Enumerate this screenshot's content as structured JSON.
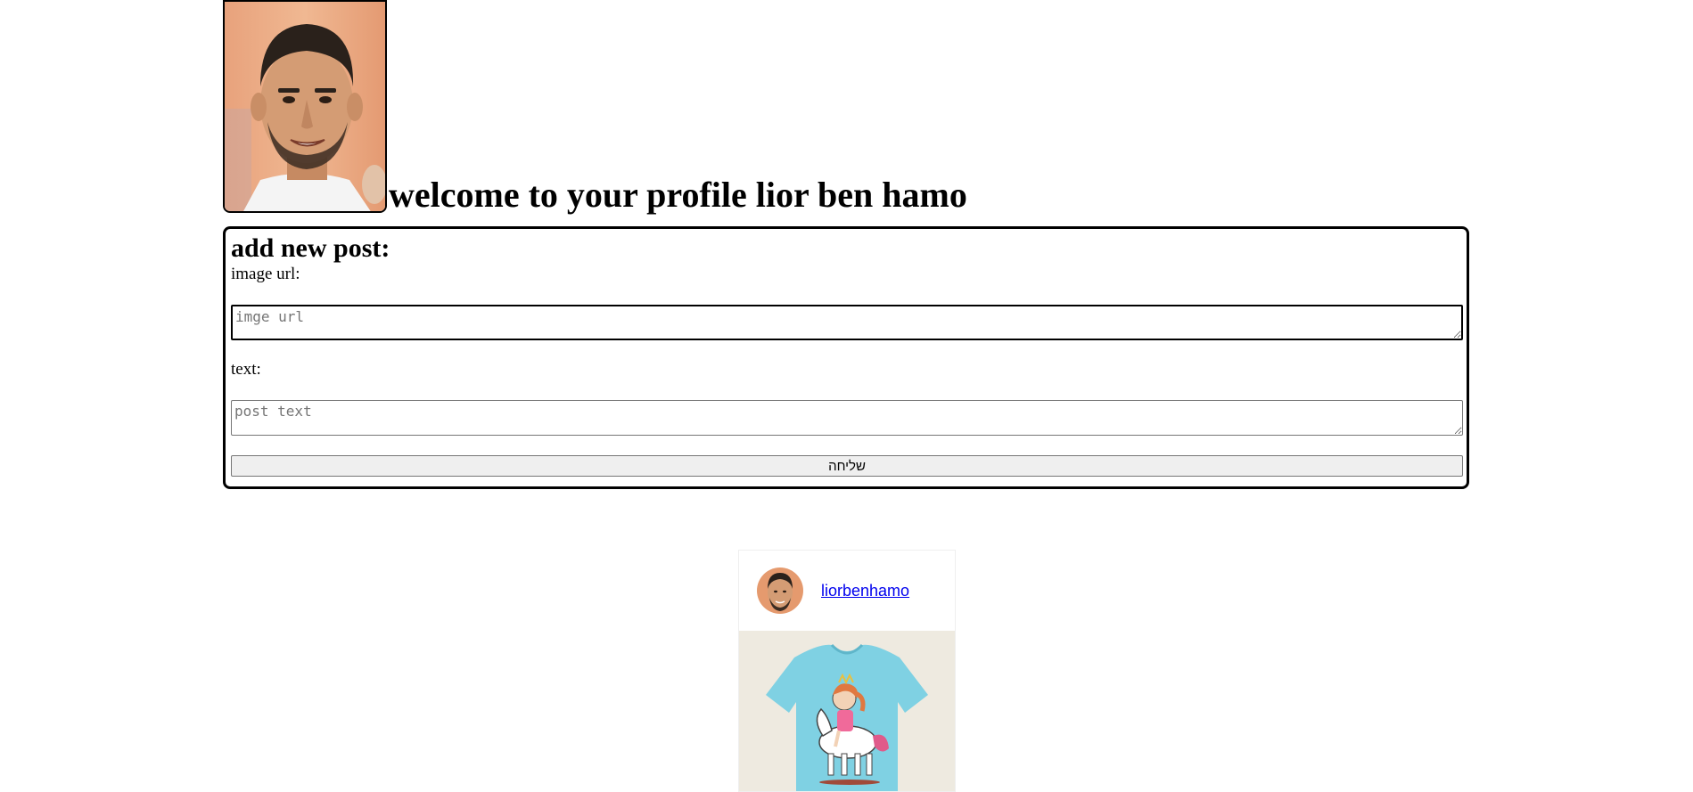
{
  "profile": {
    "welcome_title": "welcome to your profile lior ben hamo",
    "photo_alt": "profile photo"
  },
  "form": {
    "title": "add new post:",
    "image_label": "image url:",
    "image_placeholder": "imge url",
    "text_label": "text:",
    "text_placeholder": "post text",
    "submit_label": "שליחה"
  },
  "posts": [
    {
      "username": "liorbenhamo",
      "image_description_icon": "shirt-image"
    }
  ],
  "colors": {
    "link": "#0000ee",
    "border": "#000000",
    "button_bg": "#efefef",
    "shirt": "#7fd1e3"
  }
}
